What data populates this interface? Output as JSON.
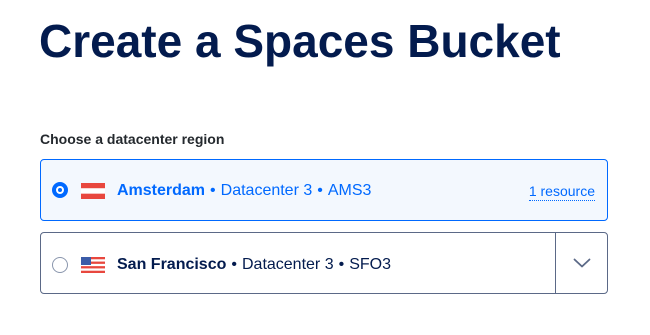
{
  "page": {
    "title": "Create a Spaces Bucket"
  },
  "region_section": {
    "label": "Choose a datacenter region",
    "options": [
      {
        "name": "Amsterdam",
        "datacenter": "Datacenter 3",
        "code": "AMS3",
        "flag_icon": "netherlands-flag-icon",
        "selected": true,
        "link_label": "1 resource"
      },
      {
        "name": "San Francisco",
        "datacenter": "Datacenter 3",
        "code": "SFO3",
        "flag_icon": "usa-flag-icon",
        "selected": false
      }
    ],
    "separator": "•"
  },
  "colors": {
    "accent": "#0069ff",
    "title": "#031b4e",
    "selected_background": "#f3f8fe",
    "border": "#5b6987"
  }
}
